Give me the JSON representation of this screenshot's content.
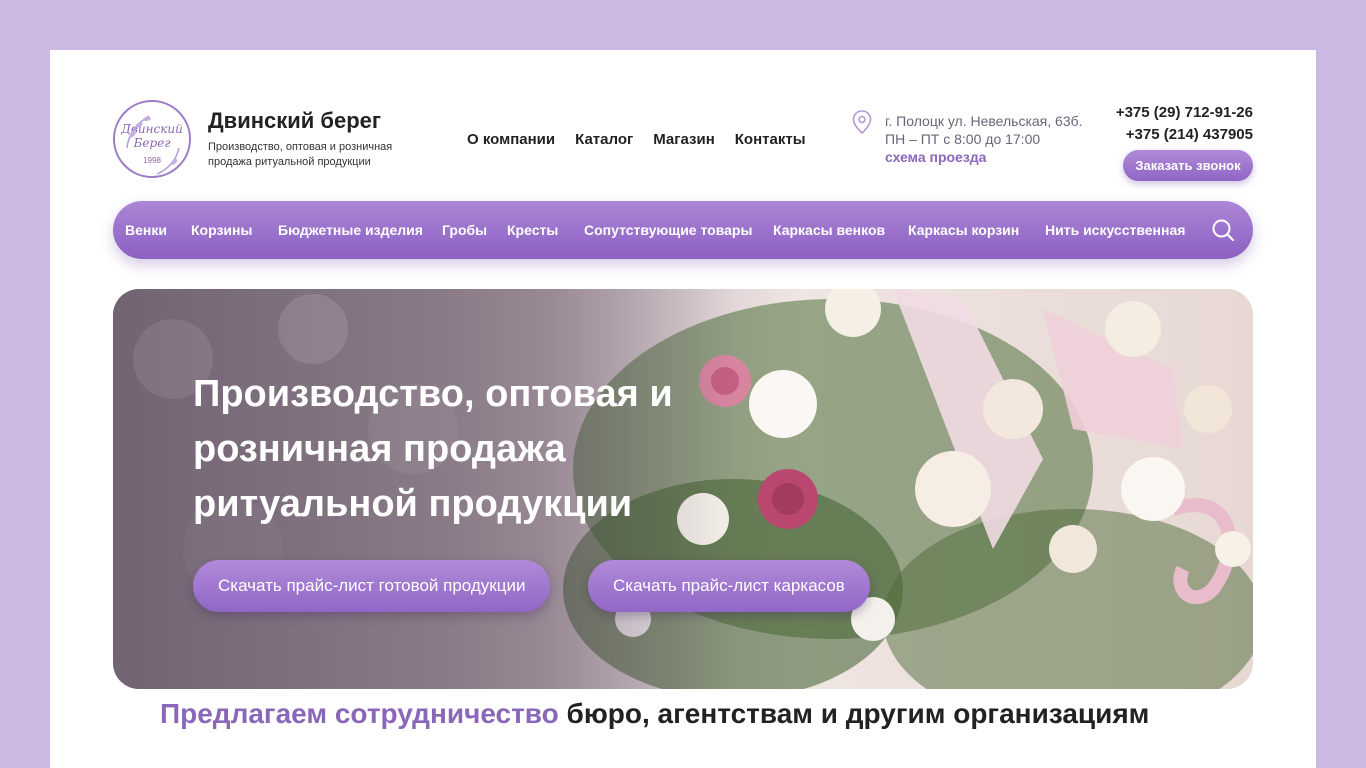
{
  "brand": {
    "logo_text": "Двинский Берег",
    "logo_year": "1998",
    "title": "Двинский берег",
    "subtitle": "Производство, оптовая и розничная продажа ритуальной продукции"
  },
  "topnav": {
    "items": [
      "О компании",
      "Каталог",
      "Магазин",
      "Контакты"
    ]
  },
  "contacts": {
    "address": "г. Полоцк ул. Невельская, 63б.",
    "hours": "ПН – ПТ с 8:00 до 17:00",
    "map_link": "схема проезда",
    "phone1": "+375 (29) 712-91-26",
    "phone2": "+375 (214) 437905",
    "callback_label": "Заказать звонок"
  },
  "catalog_nav": {
    "items": [
      "Венки",
      "Корзины",
      "Бюджетные изделия",
      "Гробы",
      "Кресты",
      "Сопутствующие товары",
      "Каркасы венков",
      "Каркасы корзин",
      "Нить искусственная"
    ]
  },
  "hero": {
    "title": "Производство, оптовая и розничная продажа ритуальной продукции",
    "button1": "Скачать прайс-лист готовой продукции",
    "button2": "Скачать прайс-лист каркасов"
  },
  "section": {
    "accent": "Предлагаем сотрудничество",
    "rest": " бюро, агентствам и другим организациям"
  },
  "colors": {
    "accent": "#8a67b8",
    "background": "#cbb9e4"
  }
}
